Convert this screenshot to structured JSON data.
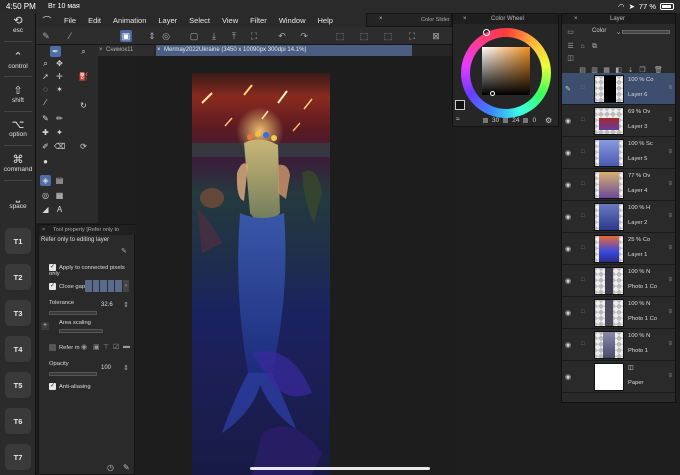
{
  "status_bar": {
    "time": "4:50 PM",
    "date": "Вт 10 мая",
    "battery": "77 %"
  },
  "modifiers": {
    "esc": "esc",
    "control": "control",
    "shift": "shift",
    "option": "option",
    "command": "command",
    "space": "space",
    "quick_buttons": [
      "T1",
      "T2",
      "T3",
      "T4",
      "T5",
      "T6",
      "T7"
    ]
  },
  "menu": {
    "items": [
      "File",
      "Edit",
      "Animation",
      "Layer",
      "Select",
      "View",
      "Filter",
      "Window",
      "Help"
    ]
  },
  "tabs": {
    "tab1": "Снимок11",
    "tab2": "Mermay2022Ukraine (3450 x 10090px 300dpi 14.1%)"
  },
  "panels": {
    "color_slider_title": "Color Slider",
    "color_wheel_title": "Color Wheel",
    "layer_title": "Layer"
  },
  "color_wheel": {
    "values": [
      "30",
      "24",
      "0"
    ],
    "current_color": "#1a1a1a"
  },
  "tool_property": {
    "title": "Tool property [Refer only to",
    "subtitle": "Refer only to editing layer",
    "apply_connected": "Apply to connected pixels only",
    "close_gap": "Close gap",
    "tolerance_label": "Tolerance",
    "tolerance_value": "32.6",
    "area_scaling_label": "Area scaling",
    "refer_multiple": "Refer m",
    "opacity_label": "Opacity",
    "opacity_value": "100",
    "antialiasing": "Anti-aliasing"
  },
  "layers": {
    "blend_mode": "Color",
    "items": [
      {
        "pct": "100 % Co",
        "name": "Layer 6"
      },
      {
        "pct": "69 % Ov",
        "name": "Layer 3"
      },
      {
        "pct": "100 % Sc",
        "name": "Layer 5"
      },
      {
        "pct": "77 % Ov",
        "name": "Layer 4"
      },
      {
        "pct": "100 % H",
        "name": "Layer 2"
      },
      {
        "pct": "25 % Co",
        "name": "Layer 1"
      },
      {
        "pct": "100 % N",
        "name": "Photo 1 Co"
      },
      {
        "pct": "100 % N",
        "name": "Photo 1 Co"
      },
      {
        "pct": "100 % N",
        "name": "Photo 1"
      },
      {
        "pct": "",
        "name": "Paper"
      }
    ]
  },
  "colors": {
    "accent": "#4b5e82",
    "selection": "#4c6da6"
  }
}
